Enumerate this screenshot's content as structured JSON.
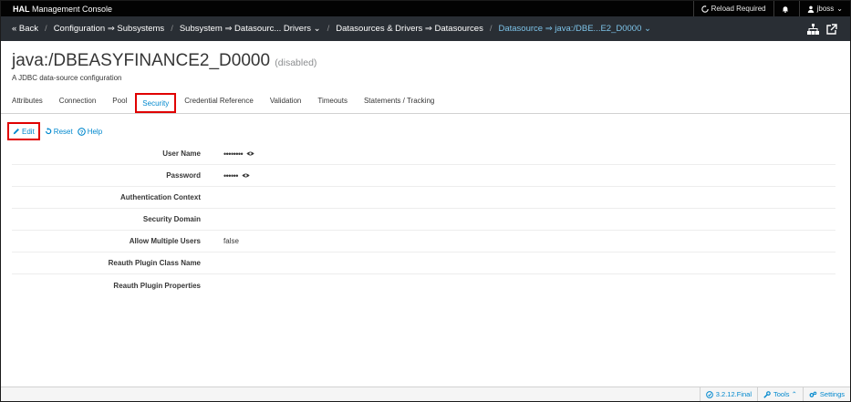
{
  "topbar": {
    "brand_bold": "HAL",
    "brand_rest": " Management Console",
    "reload_label": "Reload Required",
    "user_label": "jboss"
  },
  "breadcrumb": {
    "back": "« Back",
    "items": [
      "Configuration ⇒ Subsystems",
      "Subsystem ⇒ Datasourc... Drivers ⌄",
      "Datasources & Drivers ⇒ Datasources"
    ],
    "active": "Datasource ⇒ java:/DBE...E2_D0000 ⌄"
  },
  "header": {
    "title": "java:/DBEASYFINANCE2_D0000",
    "status": "(disabled)",
    "subtitle": "A JDBC data-source configuration"
  },
  "tabs": [
    {
      "label": "Attributes"
    },
    {
      "label": "Connection"
    },
    {
      "label": "Pool"
    },
    {
      "label": "Security",
      "active": true
    },
    {
      "label": "Credential Reference"
    },
    {
      "label": "Validation"
    },
    {
      "label": "Timeouts"
    },
    {
      "label": "Statements / Tracking"
    }
  ],
  "actions": {
    "edit": "Edit",
    "reset": "Reset",
    "help": "Help"
  },
  "attributes": [
    {
      "label": "User Name",
      "value": "••••••••",
      "masked": true
    },
    {
      "label": "Password",
      "value": "••••••",
      "masked": true
    },
    {
      "label": "Authentication Context",
      "value": ""
    },
    {
      "label": "Security Domain",
      "value": ""
    },
    {
      "label": "Allow Multiple Users",
      "value": "false"
    },
    {
      "label": "Reauth Plugin Class Name",
      "value": ""
    },
    {
      "label": "Reauth Plugin Properties",
      "value": ""
    }
  ],
  "footer": {
    "version": "3.2.12.Final",
    "tools": "Tools ⌃",
    "settings": "Settings"
  },
  "colors": {
    "accent": "#0088ce",
    "highlight": "#e00000",
    "topbar": "#030303",
    "crumbbar": "#292e34"
  }
}
